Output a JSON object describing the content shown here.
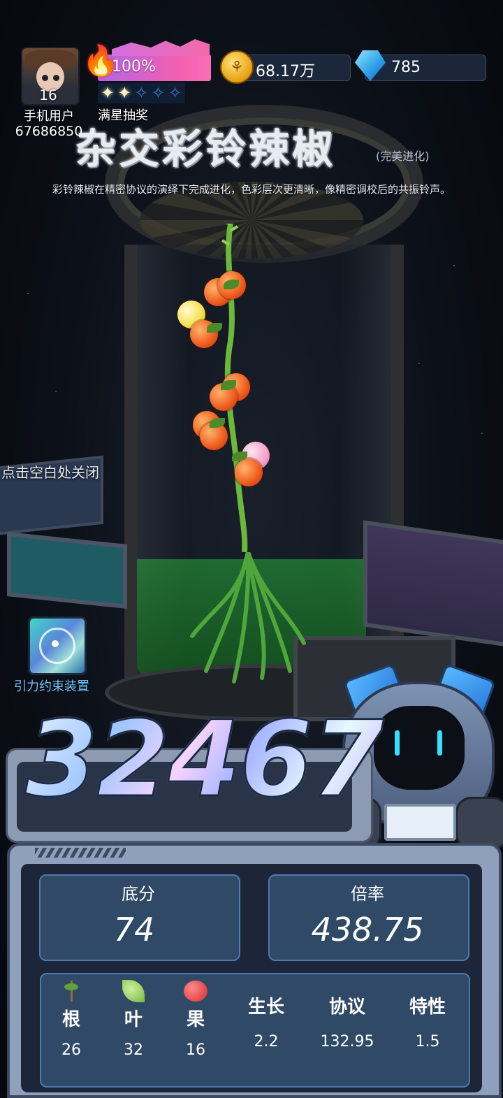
{
  "user": {
    "level": "16",
    "name": "手机用户",
    "id": "67686850"
  },
  "energy": {
    "percent_text": "100%",
    "percent_value": 100,
    "icon": "flame-icon",
    "stars_total": 5,
    "stars_filled": 2,
    "label": "满星抽奖"
  },
  "currency": {
    "coins": "68.17万",
    "coin_icon": "coin-icon",
    "gems": "785",
    "gem_icon": "gem-icon"
  },
  "plant": {
    "name": "杂交彩铃辣椒",
    "evolution_tag": "(完美进化)",
    "description": "彩铃辣椒在精密协议的演绎下完成进化，色彩层次更清晰，像精密调校后的共振铃声。"
  },
  "hints": {
    "close": "点击空白处关闭"
  },
  "device": {
    "label": "引力约束装置",
    "icon": "orbit-icon"
  },
  "score": {
    "total": "32467"
  },
  "stats": {
    "base_label": "底分",
    "base_value": "74",
    "multiplier_label": "倍率",
    "multiplier_value": "438.75"
  },
  "attributes": [
    {
      "label": "根",
      "value": "26",
      "icon": "root-icon"
    },
    {
      "label": "叶",
      "value": "32",
      "icon": "leaf-icon"
    },
    {
      "label": "果",
      "value": "16",
      "icon": "fruit-icon"
    },
    {
      "label": "生长",
      "value": "2.2"
    },
    {
      "label": "协议",
      "value": "132.95"
    },
    {
      "label": "特性",
      "value": "1.5"
    }
  ],
  "colors": {
    "energy_gradient_start": "#b066e6",
    "energy_gradient_end": "#f96eb6",
    "panel_card": "#2f4966",
    "panel_border": "#4e7ab0",
    "device_label": "#6fc4ff"
  }
}
